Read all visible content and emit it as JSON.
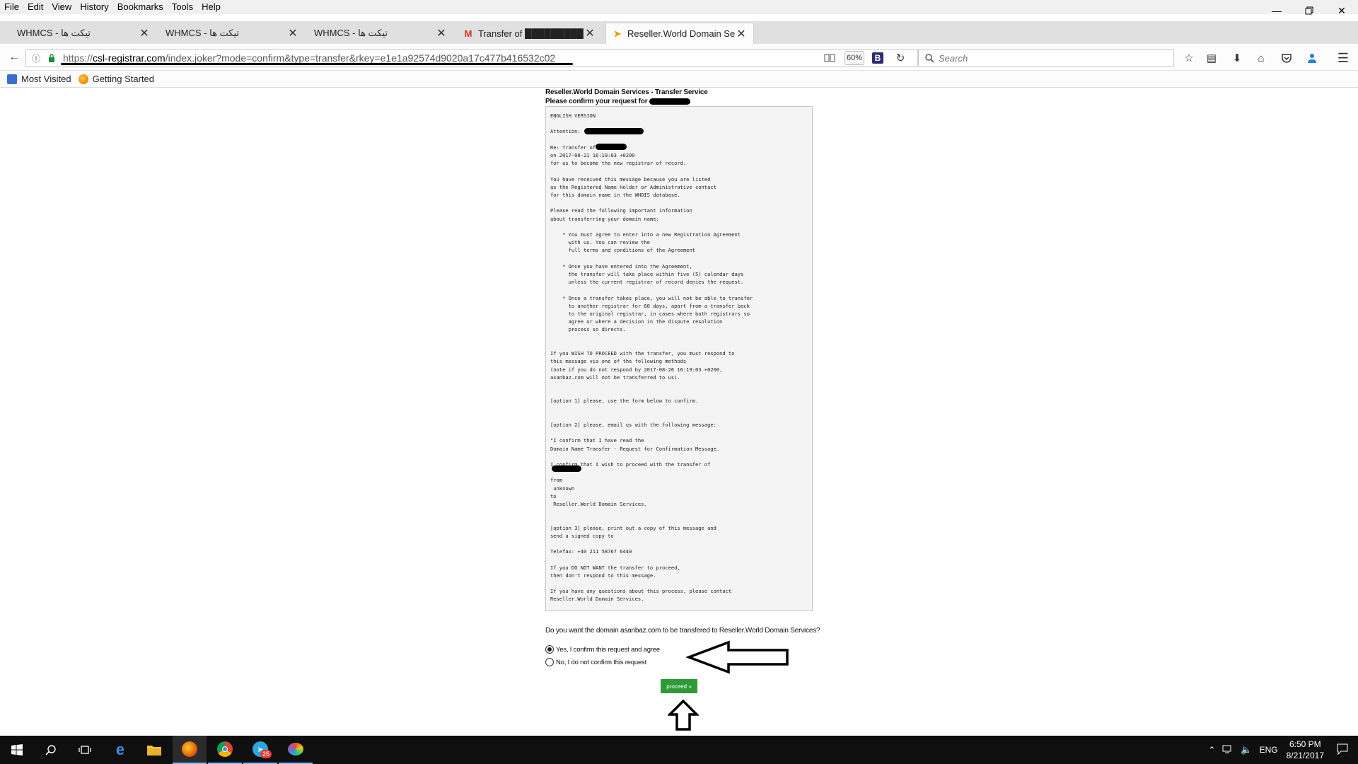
{
  "menu": {
    "items": [
      "File",
      "Edit",
      "View",
      "History",
      "Bookmarks",
      "Tools",
      "Help"
    ]
  },
  "tabs": [
    {
      "label": "WHMCS - تیکت ها",
      "active": false,
      "icon": "none"
    },
    {
      "label": "WHMCS - تیکت ها",
      "active": false,
      "icon": "none"
    },
    {
      "label": "WHMCS - تیکت ها",
      "active": false,
      "icon": "none"
    },
    {
      "label": "Transfer of ██████████m req",
      "active": false,
      "icon": "gmail-icon"
    },
    {
      "label": "Reseller.World Domain Servi",
      "active": true,
      "icon": "joker-icon"
    }
  ],
  "nav": {
    "url_prefix": "https://",
    "url_host": "csl-registrar.com",
    "url_path": "/index.joker?mode=confirm&type=transfer&rkey=e1e1a92574d9020a17c477b416532c02",
    "zoom": "60%",
    "search_placeholder": "Search"
  },
  "bookmarks": [
    "Most Visited",
    "Getting Started"
  ],
  "page": {
    "title": "Reseller.World Domain Services - Transfer Service",
    "subtitle": "Please confirm your request for",
    "message": "ENGLISH VERSION\n\nAttention:\n\nRe: Transfer of\non 2017-08-21 16:19:03 +0200\nfor us to become the new registrar of record.\n\nYou have received this message because you are listed\nas the Registered Name Holder or Administrative contact\nfor this domain name in the WHOIS database.\n\nPlease read the following important information\nabout transferring your domain name:\n\n    * You must agree to enter into a new Registration Agreement\n      with us. You can review the\n      full terms and conditions of the Agreement\n\n    * Once you have entered into the Agreement,\n      the transfer will take place within five (5) calendar days\n      unless the current registrar of record denies the request.\n\n    * Once a transfer takes place, you will not be able to transfer\n      to another registrar for 60 days, apart from a transfer back\n      to the original registrar, in cases where both registrars so\n      agree or where a decision in the dispute resolution\n      process so directs.\n\n\nIf you WISH TO PROCEED with the transfer, you must respond to\nthis message via one of the following methods\n(note if you do not respond by 2017-08-26 16:19:03 +0200,\nasanbaz.com will not be transferred to us).\n\n\n[option 1] please, use the form below to confirm.\n\n\n[option 2] please, email us with the following message:\n\n\"I confirm that I have read the\nDomain Name Transfer - Request for Confirmation Message.\n\nI confirm that I wish to proceed with the transfer of\n\nfrom\n unknown\nto\n Reseller.World Domain Services.\n\n\n[option 3] please, print out a copy of this message and\nsend a signed copy to\n\nTelefax: +40 211 58767 6440\n\nIf you DO NOT WANT the transfer to proceed,\nthen don't respond to this message.\n\nIf you have any questions about this process, please contact\nReseller.World Domain Services.",
    "question": "Do you want the domain asanbaz.com to be transfered to Reseller.World Domain Services?",
    "option_yes": "Yes, I confirm this request and agree",
    "option_no": "No, I do not confirm this request",
    "proceed": "proceed »"
  },
  "taskbar": {
    "lang": "ENG",
    "time": "6:50 PM",
    "date": "8/21/2017",
    "telegram_badge": "25"
  }
}
